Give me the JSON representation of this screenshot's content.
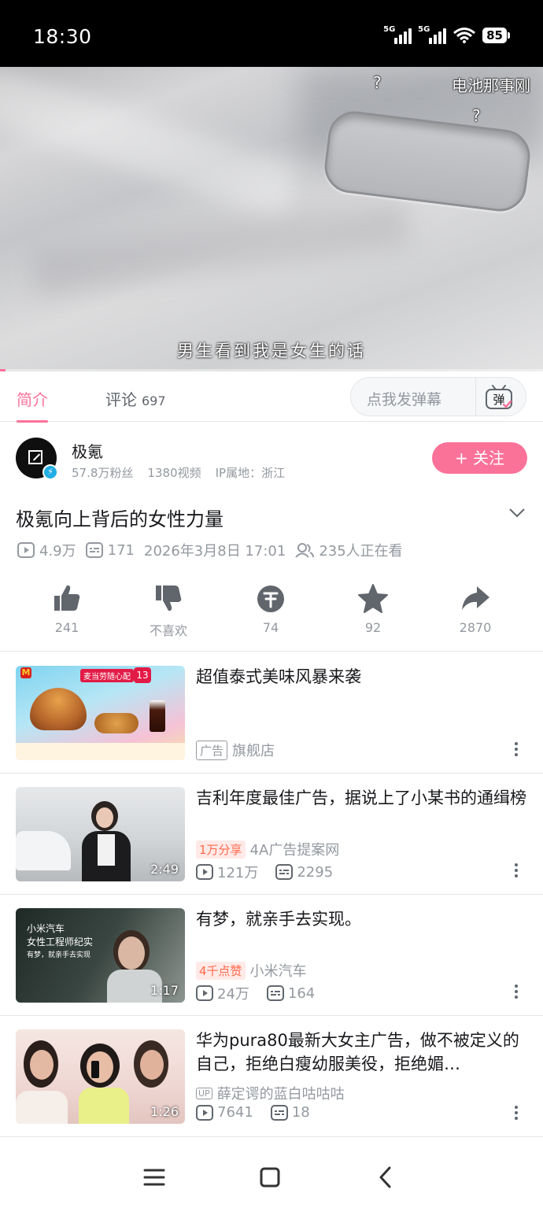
{
  "status_bar": {
    "time": "18:30",
    "network1": "5G",
    "network2": "5G",
    "battery": "85"
  },
  "video": {
    "danmaku": [
      {
        "text": "?"
      },
      {
        "text": "电池那事刚"
      },
      {
        "text": "?"
      }
    ],
    "subtitle": "男生看到我是女生的话",
    "progress_fraction": 0.01
  },
  "tabs": {
    "intro": "简介",
    "comments": "评论",
    "comments_count": "697",
    "danmaku_placeholder": "点我发弹幕",
    "danmaku_button": "弹"
  },
  "uploader": {
    "name": "极氪",
    "fans": "57.8万粉丝",
    "videos": "1380视频",
    "ip": "IP属地：浙江",
    "follow_label": "+ 关注"
  },
  "video_info": {
    "title": "极氪向上背后的女性力量",
    "views": "4.9万",
    "danmaku_count": "171",
    "date": "2026年3月8日 17:01",
    "watching": "235人正在看"
  },
  "actions": {
    "like": "241",
    "dislike": "不喜欢",
    "coin": "74",
    "favorite": "92",
    "share": "2870"
  },
  "recommendations": [
    {
      "title": "超值泰式美味风暴来袭",
      "badge": "广告",
      "channel": "旗舰店",
      "thumb_texts": [
        "麦当劳随心配",
        "13"
      ]
    },
    {
      "title": "吉利年度最佳广告，据说上了小某书的通缉榜",
      "badge": "1万分享",
      "channel": "4A广告提案网",
      "views": "121万",
      "comments": "2295",
      "duration": "2:49"
    },
    {
      "title": "有梦，就亲手去实现。",
      "badge": "4千点赞",
      "channel": "小米汽车",
      "views": "24万",
      "comments": "164",
      "duration": "1:17",
      "thumb_texts": [
        "小米汽车",
        "女性工程师纪实",
        "有梦，就亲手去实现"
      ]
    },
    {
      "title": "华为pura80最新大女主广告，做不被定义的自己，拒绝白瘦幼服美役，拒绝媚…",
      "badge": "UP",
      "channel": "薛定谔的蓝白咕咕咕",
      "views": "7641",
      "comments": "18",
      "duration": "1:26"
    }
  ],
  "colors": {
    "accent": "#fb7299",
    "muted": "#9499a0"
  }
}
